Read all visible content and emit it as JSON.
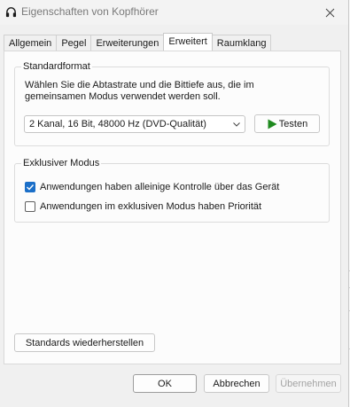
{
  "window": {
    "title": "Eigenschaften von Kopfhörer",
    "title_icon": "headphones-icon",
    "close_icon": "close-icon"
  },
  "tabs": [
    {
      "label": "Allgemein",
      "active": false
    },
    {
      "label": "Pegel",
      "active": false
    },
    {
      "label": "Erweiterungen",
      "active": false
    },
    {
      "label": "Erweitert",
      "active": true
    },
    {
      "label": "Raumklang",
      "active": false
    }
  ],
  "standard_format": {
    "legend": "Standardformat",
    "description": "Wählen Sie die Abtastrate und die Bittiefe aus, die im gemeinsamen Modus verwendet werden soll.",
    "selected_format": "2 Kanal, 16 Bit, 48000 Hz (DVD-Qualität)",
    "test_button": "Testen",
    "test_icon": "play-icon"
  },
  "exclusive_mode": {
    "legend": "Exklusiver Modus",
    "options": [
      {
        "label": "Anwendungen haben alleinige Kontrolle über das Gerät",
        "checked": true
      },
      {
        "label": "Anwendungen im exklusiven Modus haben Priorität",
        "checked": false
      }
    ]
  },
  "restore_button": "Standards wiederherstellen",
  "footer": {
    "ok": "OK",
    "cancel": "Abbrechen",
    "apply": "Übernehmen"
  },
  "colors": {
    "accent": "#1b6fc8",
    "play_green": "#1f8a1f"
  }
}
